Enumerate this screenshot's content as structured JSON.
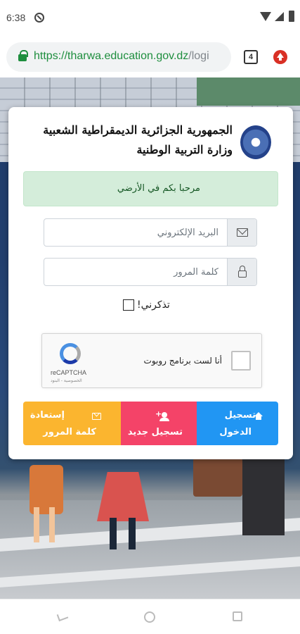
{
  "status_bar": {
    "time": "6:38"
  },
  "browser": {
    "url_host": "https://tharwa.education.gov.dz",
    "url_path": "/logi",
    "tab_count": "4",
    "icons": {
      "lock": "lock-icon",
      "update": "update-icon"
    }
  },
  "header": {
    "line1": "الجمهورية الجزائرية الديمقراطية الشعبية",
    "line2": "وزارة التربية الوطنية"
  },
  "welcome": {
    "text": "مرحبا بكم في الأرضي"
  },
  "form": {
    "email_placeholder": "البريد الإلكتروني",
    "password_placeholder": "كلمة المرور",
    "remember_label": "تذكرني!",
    "remember_checked": false
  },
  "captcha": {
    "label": "أنا لست برنامج روبوت",
    "brand": "reCAPTCHA",
    "terms": "الخصوصية - البنود"
  },
  "buttons": {
    "login_line1": "تسجيل",
    "login_line2": "الدخول",
    "register": "تسجيل جديد",
    "recover_line1": "إستعادة",
    "recover_line2": "كلمة المرور"
  },
  "colors": {
    "login": "#2196f3",
    "register": "#f44368",
    "recover": "#fbb52f",
    "welcome_bg": "#d4edda",
    "welcome_text": "#155724"
  }
}
